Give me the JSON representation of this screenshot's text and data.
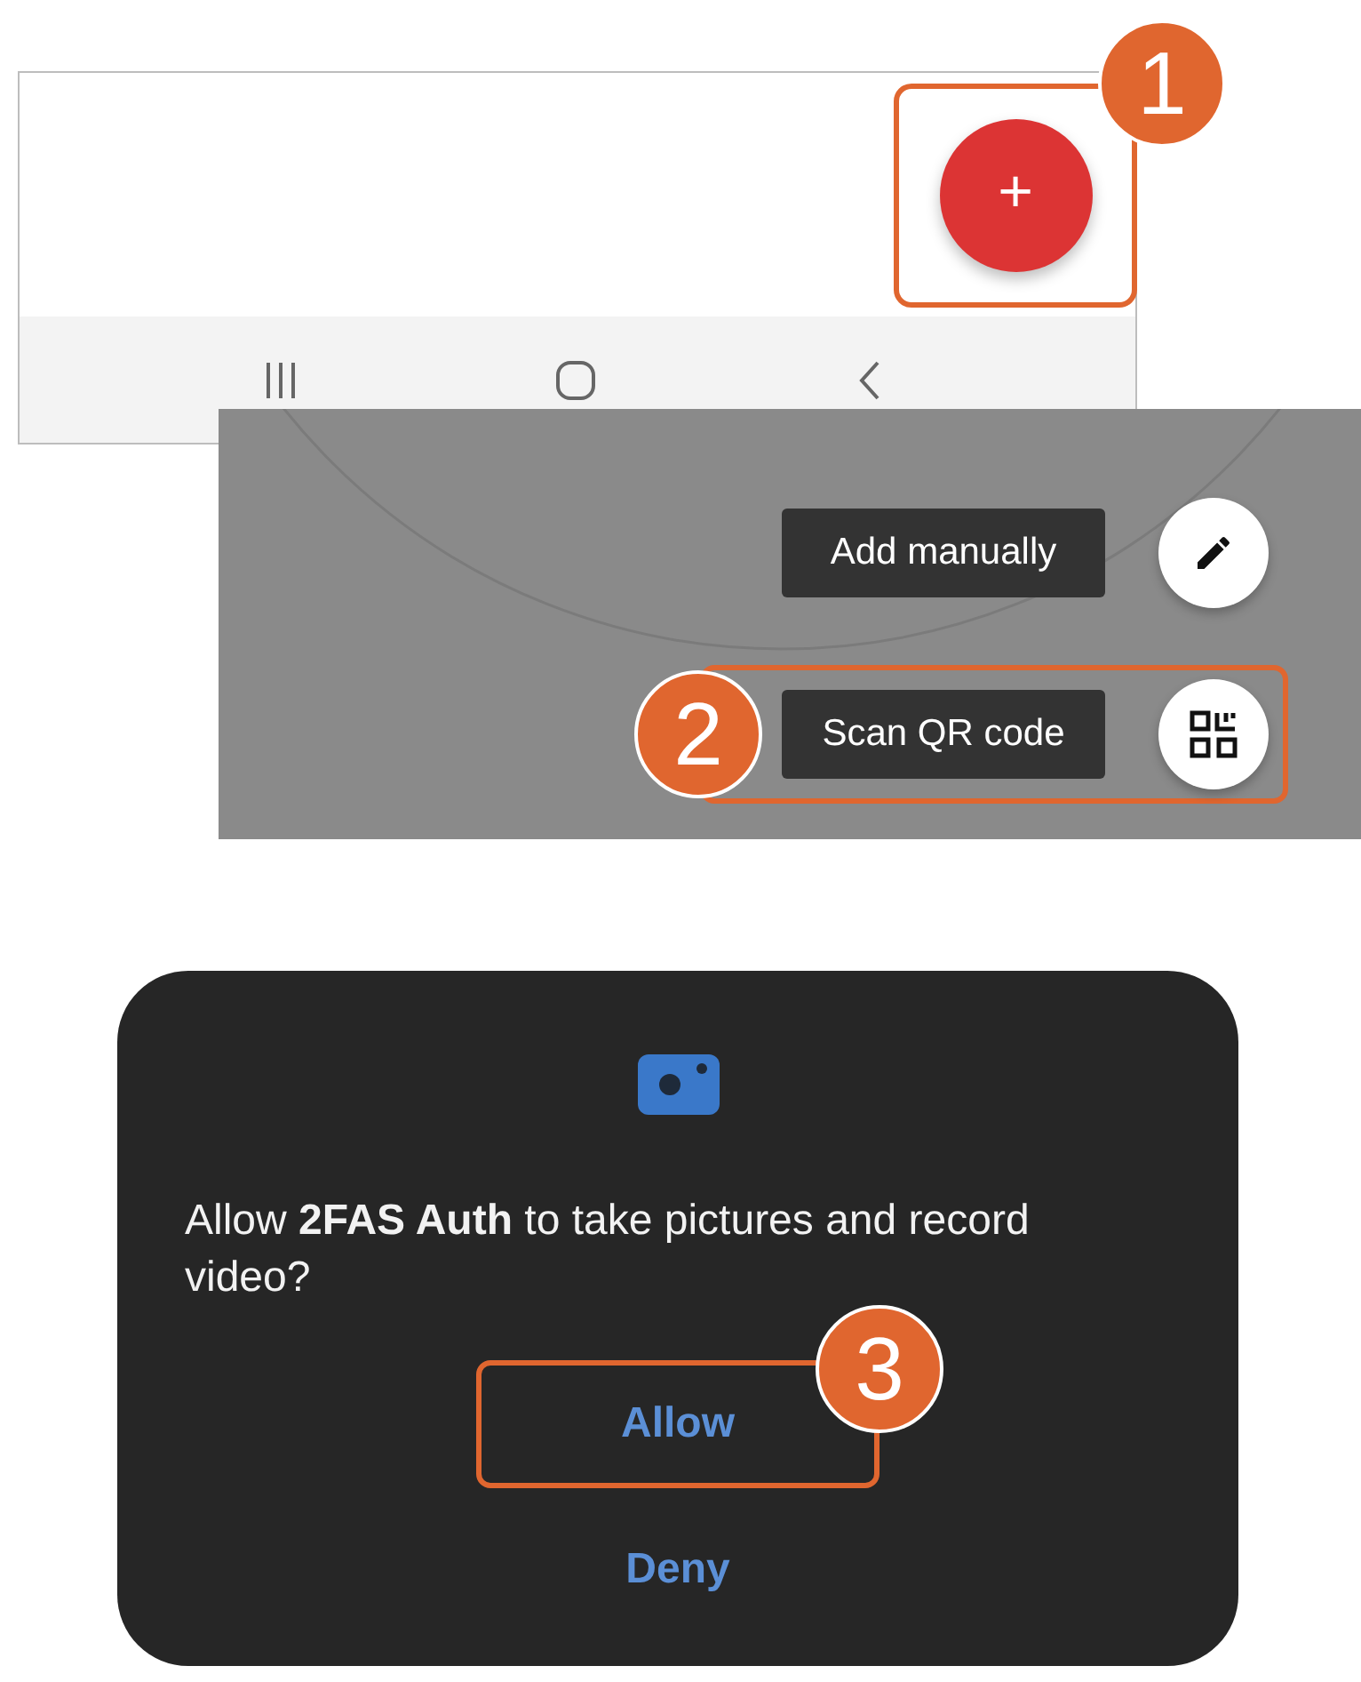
{
  "home_screen": {
    "fab": {
      "label": "+",
      "highlighted": true,
      "step": "1"
    }
  },
  "add_menu": {
    "items": [
      {
        "kind": "edit",
        "label": "Add manually",
        "highlighted": false
      },
      {
        "kind": "qr",
        "label": "Scan QR code",
        "highlighted": true,
        "step": "2"
      }
    ]
  },
  "permission_dialog": {
    "message": "Allow **2FAS Auth** to take pictures and record video?",
    "buttons": [
      {
        "label": "Allow",
        "highlighted": true,
        "step": "3"
      },
      {
        "label": "Deny",
        "highlighted": false
      }
    ]
  }
}
